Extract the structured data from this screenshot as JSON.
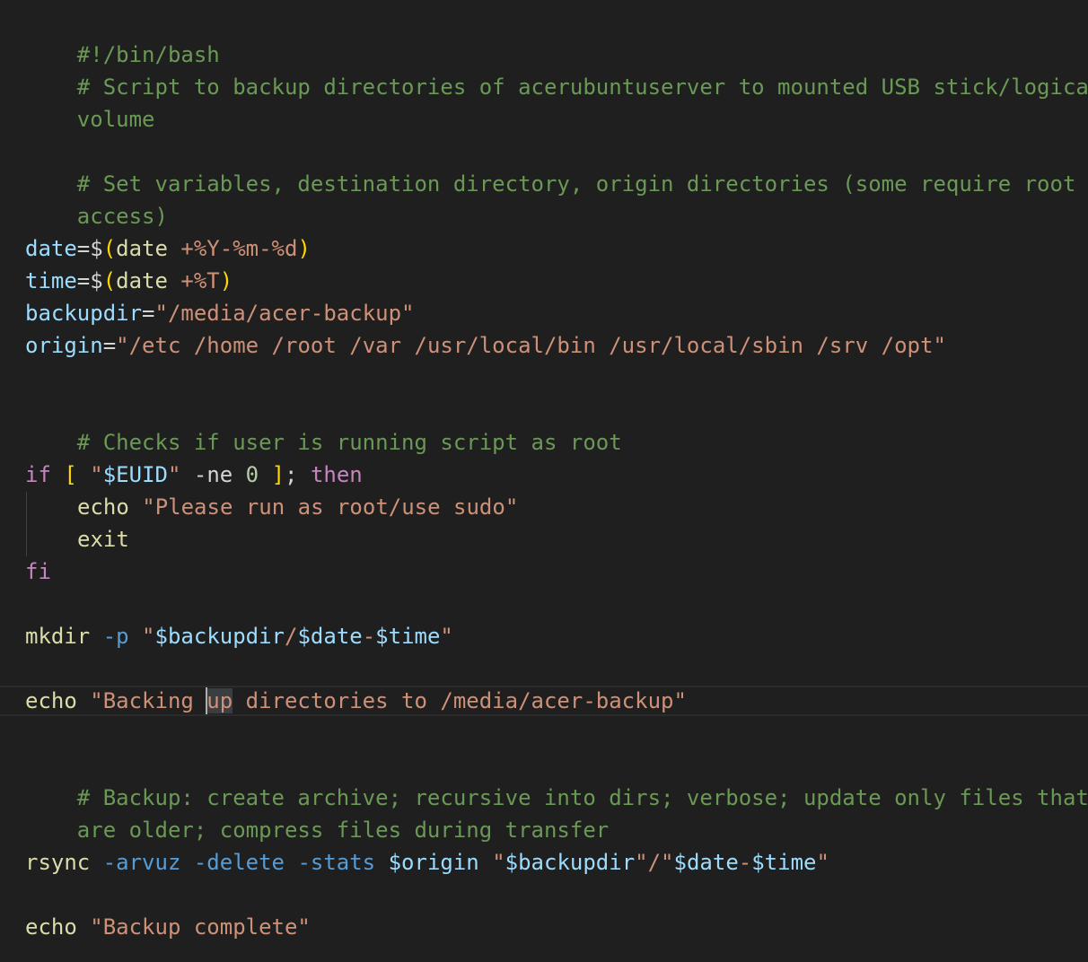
{
  "editor": {
    "language": "bash",
    "colors": {
      "background": "#1f1f1f",
      "comment": "#6a9955",
      "variable": "#9cdcfe",
      "string": "#ce9178",
      "keyword": "#c586c0",
      "command": "#dcdcaa",
      "flag": "#569cd6",
      "bracket": "#ffd700"
    },
    "lines": {
      "shebang": "#!/bin/bash",
      "comment1a": "# Script to backup directories of acerubuntuserver to mounted USB stick/logical",
      "comment1b": "volume",
      "comment2a": "# Set variables, destination directory, origin directories (some require root",
      "comment2b": "access)",
      "date_var": "date",
      "date_eq": "=$",
      "date_open": "(",
      "date_cmd": "date",
      "date_arg": " +%Y-%m-%d",
      "date_close": ")",
      "time_var": "time",
      "time_eq": "=$",
      "time_open": "(",
      "time_cmd": "date",
      "time_arg": " +%T",
      "time_close": ")",
      "backupdir_var": "backupdir",
      "backupdir_eq": "=",
      "backupdir_val": "\"/media/acer-backup\"",
      "origin_var": "origin",
      "origin_eq": "=",
      "origin_val": "\"/etc /home /root /var /usr/local/bin /usr/local/sbin /srv /opt\"",
      "comment3": "# Checks if user is running script as root",
      "if_kw": "if",
      "if_sp": " ",
      "if_open": "[",
      "if_q1": " \"",
      "if_var": "$EUID",
      "if_q2": "\"",
      "if_op": " -ne ",
      "if_num": "0",
      "if_close": " ]",
      "if_semi": "; ",
      "then_kw": "then",
      "echo1_cmd": "echo",
      "echo1_str": " \"Please run as root/use sudo\"",
      "exit_cmd": "exit",
      "fi_kw": "fi",
      "mkdir_cmd": "mkdir",
      "mkdir_flag": " -p",
      "mkdir_q1": " \"",
      "mkdir_var1": "$backupdir",
      "mkdir_slash": "/",
      "mkdir_var2": "$date",
      "mkdir_dash": "-",
      "mkdir_var3": "$time",
      "mkdir_q2": "\"",
      "echo2_cmd": "echo",
      "echo2_str": " \"Backing up directories to /media/acer-backup\"",
      "comment4a": "# Backup: create archive; recursive into dirs; verbose; update only files that",
      "comment4b": "are older; compress files during transfer",
      "rsync_cmd": "rsync",
      "rsync_flags": " -arvuz -delete -stats",
      "rsync_sp": " ",
      "rsync_var1": "$origin",
      "rsync_q1": " \"",
      "rsync_var2": "$backupdir",
      "rsync_q2": "\"/\"",
      "rsync_var3": "$date",
      "rsync_dash": "-",
      "rsync_var4": "$time",
      "rsync_q3": "\"",
      "echo3_cmd": "echo",
      "echo3_str": " \"Backup complete\""
    }
  }
}
